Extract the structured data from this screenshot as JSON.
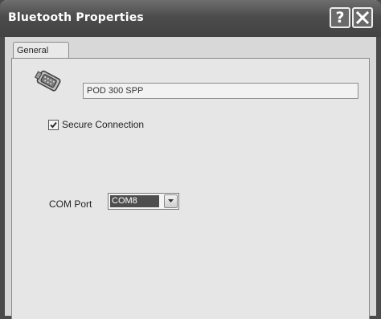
{
  "window": {
    "title": "Bluetooth Properties",
    "help_icon": "question-mark-icon",
    "close_icon": "close-x-icon"
  },
  "tabs": [
    {
      "label": "General",
      "selected": true
    }
  ],
  "general": {
    "device_icon": "serial-connector-icon",
    "device_name": "POD 300 SPP",
    "secure_connection": {
      "label": "Secure Connection",
      "checked": true
    },
    "com_port": {
      "label": "COM Port",
      "value": "COM8"
    }
  }
}
